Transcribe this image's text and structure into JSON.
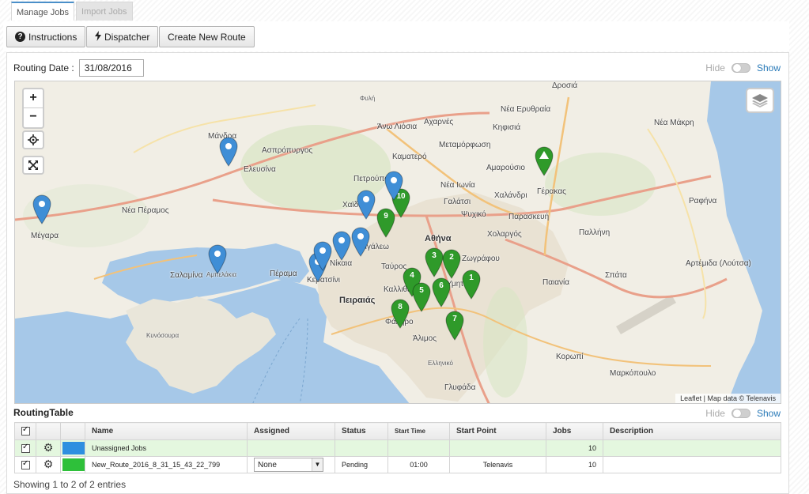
{
  "tabs": [
    {
      "label": "Manage Jobs",
      "active": true
    },
    {
      "label": "Import Jobs",
      "active": false
    }
  ],
  "toolbar": {
    "instructions_label": "Instructions",
    "dispatcher_label": "Dispatcher",
    "create_route_label": "Create New Route"
  },
  "routing_date": {
    "label": "Routing Date :",
    "value": "31/08/2016"
  },
  "map_toggle": {
    "hide": "Hide",
    "show": "Show"
  },
  "map": {
    "zoom_in": "+",
    "zoom_out": "−",
    "attribution_leaflet": "Leaflet",
    "attribution_sep": "| Map data ©",
    "attribution_owner": "Telenavis",
    "places": [
      {
        "id": "athina",
        "text": "Αθήνα"
      },
      {
        "id": "peiraias",
        "text": "Πειραιάς"
      },
      {
        "id": "salamina",
        "text": "Σαλαμίνα"
      },
      {
        "id": "elefsina",
        "text": "Ελευσίνα"
      },
      {
        "id": "megara",
        "text": "Μέγαρα"
      },
      {
        "id": "aspropyrgos",
        "text": "Ασπρόπυργος"
      },
      {
        "id": "mandra",
        "text": "Μάνδρα"
      },
      {
        "id": "nea-peramos",
        "text": "Νέα Πέραμος"
      },
      {
        "id": "acharnes",
        "text": "Αχαρνές"
      },
      {
        "id": "kifisia",
        "text": "Κηφισιά"
      },
      {
        "id": "drosia",
        "text": "Δροσιά"
      },
      {
        "id": "nea-erythraia",
        "text": "Νέα Ερυθραία"
      },
      {
        "id": "nea-makri",
        "text": "Νέα Μάκρη"
      },
      {
        "id": "ano-liosia",
        "text": "Άνω Λιόσια"
      },
      {
        "id": "metamorfosi",
        "text": "Μεταμόρφωση"
      },
      {
        "id": "kamatero",
        "text": "Καματερό"
      },
      {
        "id": "amarousio",
        "text": "Αμαρούσιο"
      },
      {
        "id": "nea-ionia",
        "text": "Νέα Ιωνία"
      },
      {
        "id": "galatsi",
        "text": "Γαλάτσι"
      },
      {
        "id": "chalandri",
        "text": "Χαλάνδρι"
      },
      {
        "id": "psychiko",
        "text": "Ψυχικό"
      },
      {
        "id": "paraskevi",
        "text": "Παρασκευή"
      },
      {
        "id": "cholargos",
        "text": "Χολαργός"
      },
      {
        "id": "gerakas",
        "text": "Γέρακας"
      },
      {
        "id": "pallini",
        "text": "Παλλήνη"
      },
      {
        "id": "rafina",
        "text": "Ραφήνα"
      },
      {
        "id": "artemida",
        "text": "Αρτέμιδα (Λούτσα)"
      },
      {
        "id": "spata",
        "text": "Σπάτα"
      },
      {
        "id": "paiania",
        "text": "Παιανία"
      },
      {
        "id": "koropi",
        "text": "Κορωπί"
      },
      {
        "id": "markopoulo",
        "text": "Μαρκόπουλο"
      },
      {
        "id": "glyfada",
        "text": "Γλυφάδα"
      },
      {
        "id": "alimos",
        "text": "Άλιμος"
      },
      {
        "id": "kallithea",
        "text": "Καλλιθέα"
      },
      {
        "id": "nikaia",
        "text": "Νίκαια"
      },
      {
        "id": "keratsini",
        "text": "Κερατσίνι"
      },
      {
        "id": "perama",
        "text": "Πέραμα"
      },
      {
        "id": "aigaleo",
        "text": "Αιγάλεω"
      },
      {
        "id": "chaidari",
        "text": "Χαϊδάρι"
      },
      {
        "id": "petroupoli",
        "text": "Πετρούπολη"
      },
      {
        "id": "tavros",
        "text": "Ταύρος"
      },
      {
        "id": "zografou",
        "text": "Ζωγράφου"
      },
      {
        "id": "ymittos",
        "text": "Υμηττός"
      },
      {
        "id": "faliro",
        "text": "Φάληρο"
      },
      {
        "id": "ellinikо",
        "text": "Ελληνικό"
      },
      {
        "id": "fyli",
        "text": "Φυλή"
      },
      {
        "id": "ampelakia",
        "text": "Αμπελάκια"
      },
      {
        "id": "kynosoura",
        "text": "Κυνόσουρα"
      }
    ],
    "route_markers": [
      "1",
      "2",
      "3",
      "4",
      "5",
      "6",
      "7",
      "8",
      "9",
      "10"
    ],
    "route_color": "#2f9a2a",
    "unassigned_color": "#3f8ed6"
  },
  "routing_table": {
    "title": "RoutingTable",
    "toggle": {
      "hide": "Hide",
      "show": "Show"
    },
    "columns": [
      "Name",
      "Assigned",
      "Status",
      "Start Time",
      "Start Point",
      "Jobs",
      "Description"
    ],
    "rows": [
      {
        "name": "Unassigned Jobs",
        "assigned": "",
        "status": "",
        "start_time": "",
        "start_point": "",
        "jobs": "10",
        "description": "",
        "color": "#2e8fe0"
      },
      {
        "name": "New_Route_2016_8_31_15_43_22_799",
        "assigned": "None",
        "status": "Pending",
        "start_time": "01:00",
        "start_point": "Telenavis",
        "jobs": "10",
        "description": "",
        "color": "#2ec03a"
      }
    ],
    "footer": "Showing 1 to 2 of 2 entries"
  }
}
